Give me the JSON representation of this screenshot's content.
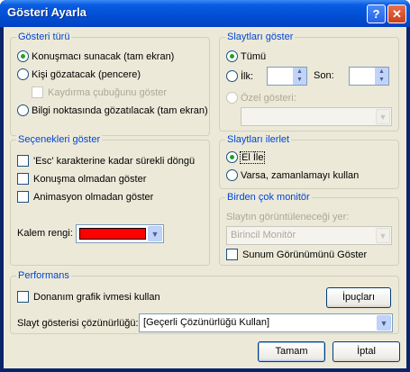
{
  "window": {
    "title": "Gösteri Ayarla",
    "help_glyph": "?",
    "close_glyph": "✕"
  },
  "show_type": {
    "legend": "Gösteri türü",
    "options": [
      {
        "label": "Konuşmacı sunacak (tam ekran)",
        "selected": true
      },
      {
        "label": "Kişi gözatacak (pencere)",
        "selected": false
      },
      {
        "label": "Bilgi noktasında gözatılacak (tam ekran)",
        "selected": false
      }
    ],
    "scrollbar_check": "Kaydırma çubuğunu göster"
  },
  "show_slides": {
    "legend": "Slaytları göster",
    "all": "Tümü",
    "from": "İlk:",
    "to": "Son:",
    "from_value": "",
    "to_value": "",
    "custom": "Özel gösteri:",
    "custom_value": ""
  },
  "show_options": {
    "legend": "Seçenekleri göster",
    "loop": "'Esc' karakterine kadar sürekli döngü",
    "no_narration": "Konuşma olmadan göster",
    "no_animation": "Animasyon olmadan göster",
    "pen_color_label": "Kalem rengi:",
    "pen_color": "#ff0000"
  },
  "advance_slides": {
    "legend": "Slaytları ilerlet",
    "manual": "El İle",
    "timings": "Varsa, zamanlamayı kullan"
  },
  "multiple_monitors": {
    "legend": "Birden çok monitör",
    "display_on_label": "Slaytın görüntüleneceği yer:",
    "display_on_value": "Birincil Monitör",
    "presenter_view": "Sunum Görünümünü Göster"
  },
  "performance": {
    "legend": "Performans",
    "hw_accel": "Donanım grafik ivmesi kullan",
    "tips_button": "İpuçları",
    "resolution_label": "Slayt gösterisi çözünürlüğü:",
    "resolution_value": "[Geçerli Çözünürlüğü Kullan]"
  },
  "buttons": {
    "ok": "Tamam",
    "cancel": "İptal"
  }
}
